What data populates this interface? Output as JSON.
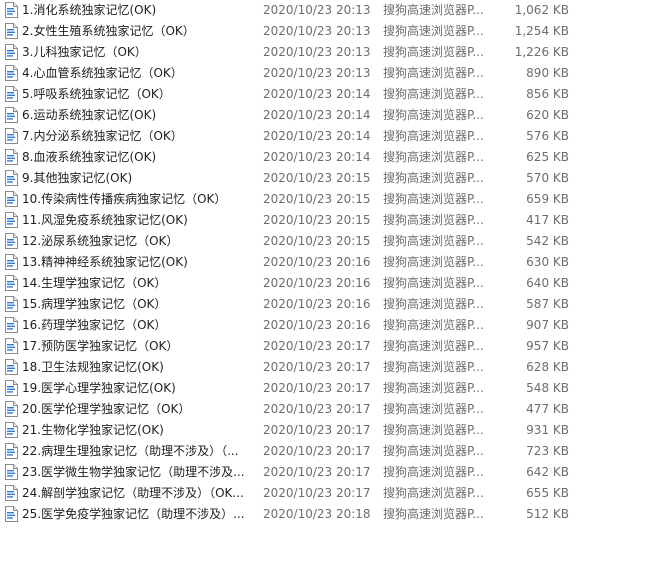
{
  "columns": [
    "name",
    "date_modified",
    "type",
    "size"
  ],
  "file_icon": "pdf-document-icon",
  "files": [
    {
      "name": "1.消化系统独家记忆(OK)",
      "date": "2020/10/23 20:13",
      "type": "搜狗高速浏览器P...",
      "size": "1,062 KB"
    },
    {
      "name": "2.女性生殖系统独家记忆（OK）",
      "date": "2020/10/23 20:13",
      "type": "搜狗高速浏览器P...",
      "size": "1,254 KB"
    },
    {
      "name": "3.儿科独家记忆（OK）",
      "date": "2020/10/23 20:13",
      "type": "搜狗高速浏览器P...",
      "size": "1,226 KB"
    },
    {
      "name": "4.心血管系统独家记忆（OK）",
      "date": "2020/10/23 20:13",
      "type": "搜狗高速浏览器P...",
      "size": "890 KB"
    },
    {
      "name": "5.呼吸系统独家记忆（OK）",
      "date": "2020/10/23 20:14",
      "type": "搜狗高速浏览器P...",
      "size": "856 KB"
    },
    {
      "name": "6.运动系统独家记忆(OK)",
      "date": "2020/10/23 20:14",
      "type": "搜狗高速浏览器P...",
      "size": "620 KB"
    },
    {
      "name": "7.内分泌系统独家记忆（OK）",
      "date": "2020/10/23 20:14",
      "type": "搜狗高速浏览器P...",
      "size": "576 KB"
    },
    {
      "name": "8.血液系统独家记忆(OK)",
      "date": "2020/10/23 20:14",
      "type": "搜狗高速浏览器P...",
      "size": "625 KB"
    },
    {
      "name": "9.其他独家记忆(OK)",
      "date": "2020/10/23 20:15",
      "type": "搜狗高速浏览器P...",
      "size": "570 KB"
    },
    {
      "name": "10.传染病性传播疾病独家记忆（OK）",
      "date": "2020/10/23 20:15",
      "type": "搜狗高速浏览器P...",
      "size": "659 KB"
    },
    {
      "name": "11.风湿免疫系统独家记忆(OK)",
      "date": "2020/10/23 20:15",
      "type": "搜狗高速浏览器P...",
      "size": "417 KB"
    },
    {
      "name": "12.泌尿系统独家记忆（OK）",
      "date": "2020/10/23 20:15",
      "type": "搜狗高速浏览器P...",
      "size": "542 KB"
    },
    {
      "name": "13.精神神经系统独家记忆(OK)",
      "date": "2020/10/23 20:16",
      "type": "搜狗高速浏览器P...",
      "size": "630 KB"
    },
    {
      "name": "14.生理学独家记忆（OK）",
      "date": "2020/10/23 20:16",
      "type": "搜狗高速浏览器P...",
      "size": "640 KB"
    },
    {
      "name": "15.病理学独家记忆（OK）",
      "date": "2020/10/23 20:16",
      "type": "搜狗高速浏览器P...",
      "size": "587 KB"
    },
    {
      "name": "16.药理学独家记忆（OK）",
      "date": "2020/10/23 20:16",
      "type": "搜狗高速浏览器P...",
      "size": "907 KB"
    },
    {
      "name": "17.预防医学独家记忆（OK）",
      "date": "2020/10/23 20:17",
      "type": "搜狗高速浏览器P...",
      "size": "957 KB"
    },
    {
      "name": "18.卫生法规独家记忆(OK)",
      "date": "2020/10/23 20:17",
      "type": "搜狗高速浏览器P...",
      "size": "628 KB"
    },
    {
      "name": "19.医学心理学独家记忆(OK)",
      "date": "2020/10/23 20:17",
      "type": "搜狗高速浏览器P...",
      "size": "548 KB"
    },
    {
      "name": "20.医学伦理学独家记忆（OK）",
      "date": "2020/10/23 20:17",
      "type": "搜狗高速浏览器P...",
      "size": "477 KB"
    },
    {
      "name": "21.生物化学独家记忆(OK)",
      "date": "2020/10/23 20:17",
      "type": "搜狗高速浏览器P...",
      "size": "931 KB"
    },
    {
      "name": "22.病理生理独家记忆（助理不涉及）（...",
      "date": "2020/10/23 20:17",
      "type": "搜狗高速浏览器P...",
      "size": "723 KB"
    },
    {
      "name": "23.医学微生物学独家记忆（助理不涉及...",
      "date": "2020/10/23 20:17",
      "type": "搜狗高速浏览器P...",
      "size": "642 KB"
    },
    {
      "name": "24.解剖学独家记忆（助理不涉及）（OK...",
      "date": "2020/10/23 20:17",
      "type": "搜狗高速浏览器P...",
      "size": "655 KB"
    },
    {
      "name": "25.医学免疫学独家记忆（助理不涉及）...",
      "date": "2020/10/23 20:18",
      "type": "搜狗高速浏览器P...",
      "size": "512 KB"
    }
  ]
}
